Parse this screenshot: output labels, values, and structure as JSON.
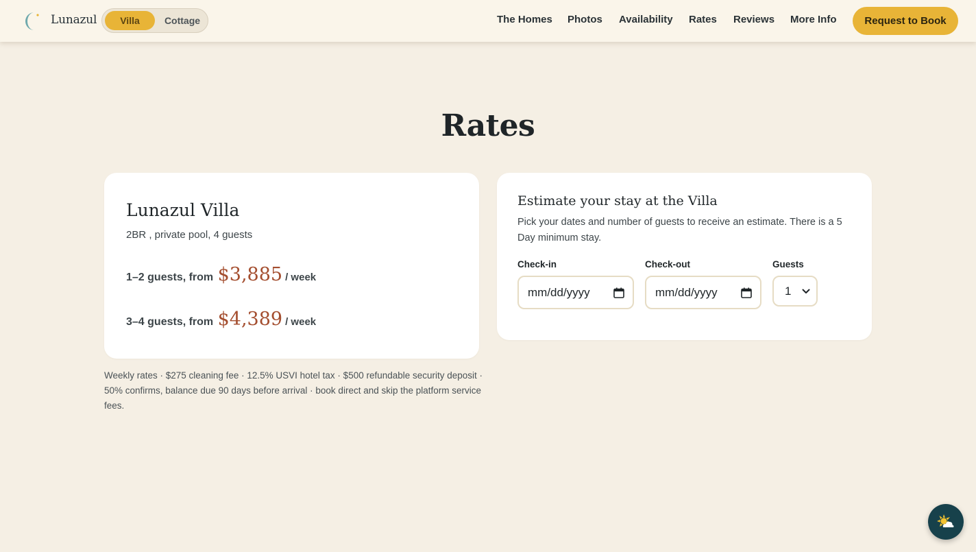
{
  "header": {
    "brand": "Lunazul",
    "toggle": {
      "villa": "Villa",
      "cottage": "Cottage",
      "selected": "Villa"
    },
    "nav": [
      "The Homes",
      "Photos",
      "Availability",
      "Rates",
      "Reviews",
      "More Info"
    ],
    "cta": "Request to Book"
  },
  "rates": {
    "title": "Rates",
    "villa": {
      "name": "Lunazul Villa",
      "subtitle": "2BR , private pool, 4 guests",
      "tiers": [
        {
          "label": "1–2 guests, from",
          "price": "$3,885",
          "unit": "/ week"
        },
        {
          "label": "3–4 guests, from",
          "price": "$4,389",
          "unit": "/ week"
        }
      ]
    },
    "fine_print": "Weekly rates · $275 cleaning fee · 12.5% USVI hotel tax · $500 refundable security deposit · 50% confirms, balance due 90 days before arrival · book direct and skip the platform service fees."
  },
  "estimate": {
    "title": "Estimate your stay at the Villa",
    "description": "Pick your dates and number of guests to receive an estimate. There is a 5 Day minimum stay.",
    "checkin_label": "Check-in",
    "checkin_placeholder": "mm/dd/yyyy",
    "checkout_label": "Check-out",
    "checkout_placeholder": "mm/dd/yyyy",
    "guests_label": "Guests",
    "guests_value": "1"
  },
  "colors": {
    "accent": "#e8b437",
    "price": "#a44e2f",
    "background": "#f5efe4",
    "widget": "#17414b"
  },
  "icons": {
    "logo": "crescent-moon-icon",
    "calendar": "calendar-icon",
    "select": "chevron-down-icon",
    "widget": "sun-cloud-icon"
  }
}
